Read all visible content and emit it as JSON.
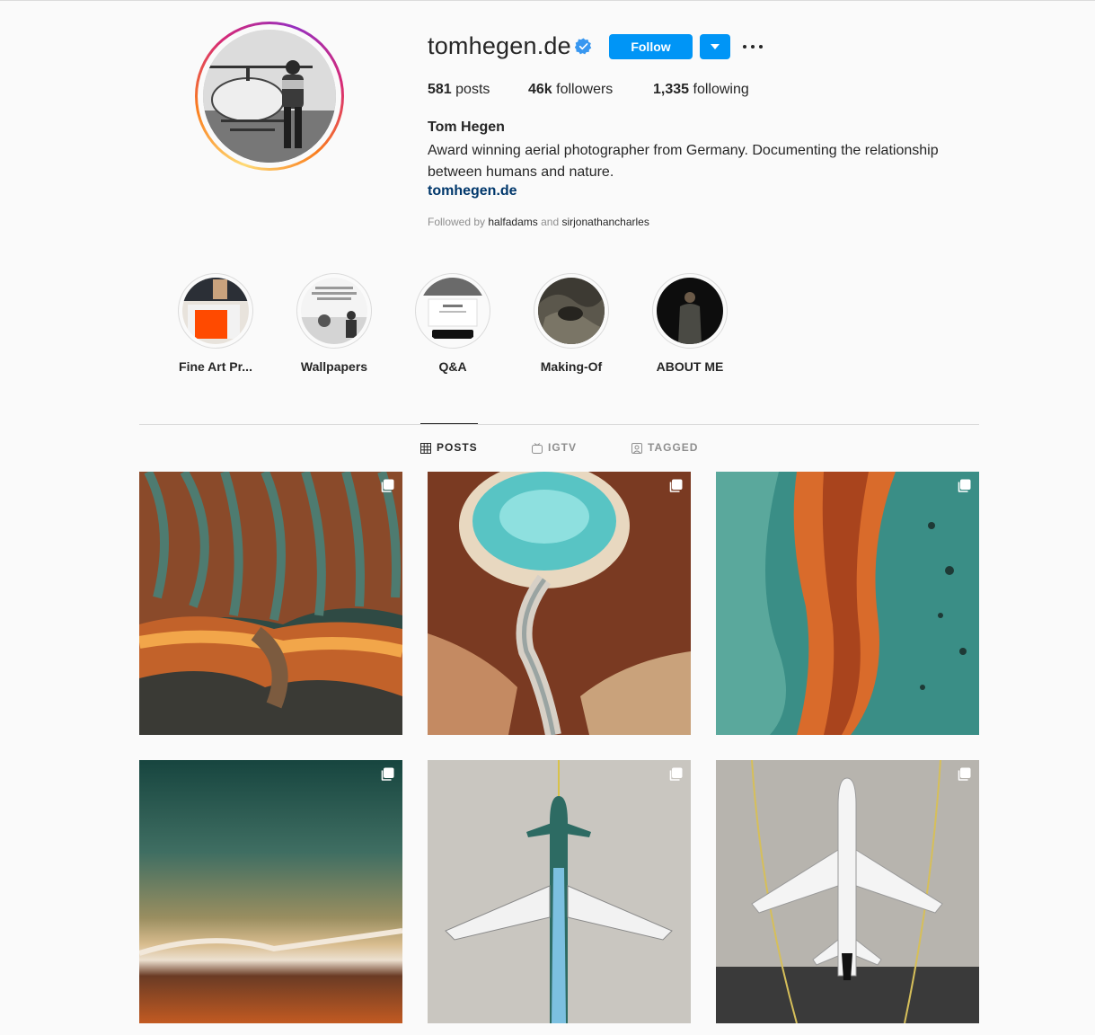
{
  "profile": {
    "username": "tomhegen.de",
    "verified": true,
    "follow_label": "Follow",
    "stats": {
      "posts_count": "581",
      "posts_label": "posts",
      "followers_count": "46k",
      "followers_label": "followers",
      "following_count": "1,335",
      "following_label": "following"
    },
    "full_name": "Tom Hegen",
    "bio": "Award winning aerial photographer from Germany. Documenting the relationship between humans and nature.",
    "website": "tomhegen.de",
    "followed_by_prefix": "Followed by",
    "followed_by_accounts": [
      "halfadams",
      "sirjonathancharles"
    ],
    "followed_by_and": "and"
  },
  "highlights": [
    {
      "label": "Fine Art Pr..."
    },
    {
      "label": "Wallpapers"
    },
    {
      "label": "Q&A"
    },
    {
      "label": "Making-Of"
    },
    {
      "label": "ABOUT ME"
    }
  ],
  "tabs": [
    {
      "label": "POSTS",
      "icon": "grid-icon",
      "active": true
    },
    {
      "label": "IGTV",
      "icon": "igtv-icon",
      "active": false
    },
    {
      "label": "TAGGED",
      "icon": "tagged-icon",
      "active": false
    }
  ],
  "posts_badge_icon": "multiple-photos-icon",
  "colors": {
    "accent": "#0095f6",
    "link": "#00376b",
    "text": "#262626",
    "muted": "#8e8e8e",
    "background": "#fafafa"
  }
}
